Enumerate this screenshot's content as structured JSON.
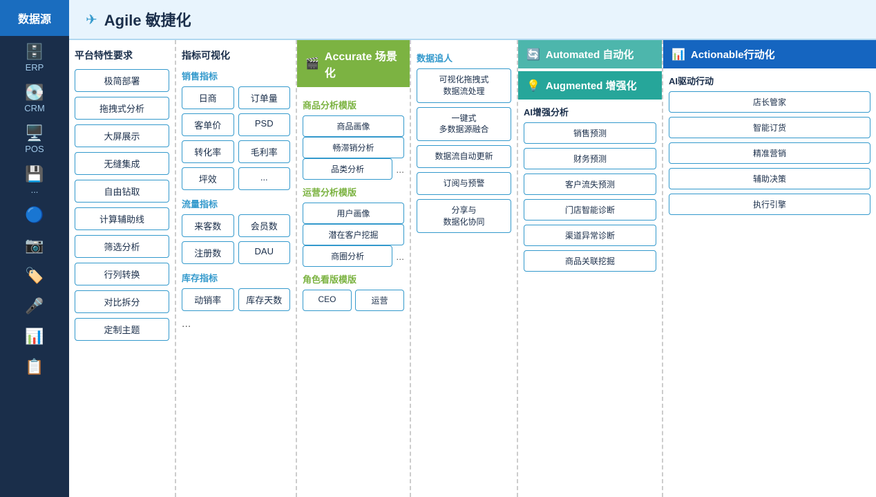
{
  "sidebar": {
    "header": "数据源",
    "items": [
      {
        "id": "erp",
        "icon": "🗄",
        "label": "ERP"
      },
      {
        "id": "crm",
        "icon": "💽",
        "label": "CRM"
      },
      {
        "id": "pos",
        "icon": "🖥",
        "label": "POS"
      },
      {
        "id": "more",
        "icon": "💾",
        "label": "..."
      },
      {
        "id": "weibo",
        "icon": "🔵",
        "label": ""
      },
      {
        "id": "camera",
        "icon": "📷",
        "label": ""
      },
      {
        "id": "label",
        "icon": "🏷",
        "label": ""
      },
      {
        "id": "mic",
        "icon": "🎤",
        "label": ""
      },
      {
        "id": "excel",
        "icon": "📊",
        "label": ""
      },
      {
        "id": "copy",
        "icon": "📋",
        "label": ""
      }
    ]
  },
  "topbar": {
    "icon": "✈",
    "title": "Agile 敏捷化"
  },
  "platform": {
    "title": "平台特性要求",
    "items": [
      "极简部署",
      "拖拽式分析",
      "大屏展示",
      "无缝集成",
      "自由钻取",
      "计算辅助线",
      "筛选分析",
      "行列转换",
      "对比拆分",
      "定制主题"
    ]
  },
  "metrics": {
    "title": "指标可视化",
    "sales_title": "销售指标",
    "sales_items": [
      "日商",
      "订单量",
      "客单价",
      "PSD",
      "转化率",
      "毛利率",
      "坪效",
      "..."
    ],
    "traffic_title": "流量指标",
    "traffic_items": [
      "来客数",
      "会员数",
      "注册数",
      "DAU"
    ],
    "inventory_title": "库存指标",
    "inventory_items": [
      "动销率",
      "库存天数"
    ],
    "ellipsis": "..."
  },
  "accurate": {
    "header_icon": "🎬",
    "header_title": "Accurate 场景化",
    "product_title": "商品分析模版",
    "product_items": [
      "商品画像",
      "畅滞销分析",
      "品类分析",
      "..."
    ],
    "ops_title": "运营分析模版",
    "ops_items": [
      "用户画像",
      "潜在客户挖掘",
      "商圈分析",
      "..."
    ],
    "role_title": "角色看版模版",
    "role_items": [
      "CEO",
      "运营"
    ]
  },
  "datatrack": {
    "title": "数据追人",
    "items": [
      "可视化拖拽式\n数据流处理",
      "一键式\n多数据源融合",
      "数据流自动更新",
      "订阅与预警",
      "分享与\n数据化协同"
    ]
  },
  "automated": {
    "header_icon": "🔄",
    "header_title": "Automated 自动化"
  },
  "augmented": {
    "header_icon": "💡",
    "header_title": "Augmented 增强化",
    "ai_title": "AI增强分析",
    "ai_items": [
      "销售预测",
      "财务预测",
      "客户流失预测",
      "门店智能诊断",
      "渠道异常诊断",
      "商品关联挖掘"
    ]
  },
  "actionable": {
    "header_icon": "📊",
    "header_title": "Actionable行动化",
    "ai_title": "AI驱动行动",
    "ai_items": [
      "店长管家",
      "智能订货",
      "精准营销",
      "辅助决策",
      "执行引擎"
    ]
  }
}
